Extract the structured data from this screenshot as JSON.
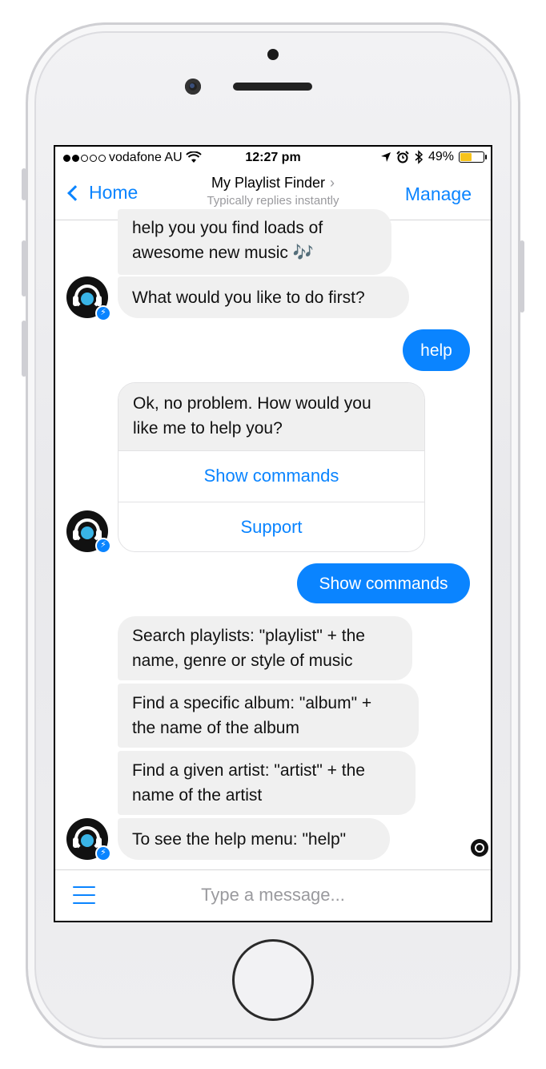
{
  "status_bar": {
    "carrier": "vodafone AU",
    "time": "12:27 pm",
    "battery": "49%",
    "battery_level": 0.49,
    "signal_bars_full": 2,
    "signal_bars_total": 5,
    "icons": [
      "wifi-icon",
      "location-arrow-icon",
      "alarm-icon",
      "bluetooth-icon",
      "battery-icon"
    ]
  },
  "nav": {
    "back_label": "Home",
    "title": "My Playlist Finder",
    "title_chevron": "›",
    "subtitle": "Typically replies instantly",
    "manage_label": "Manage"
  },
  "messages": {
    "bot1_line": "help you you find loads of",
    "bot1_line2": "awesome new music",
    "bot1_emoji": "🎶",
    "bot2": "What would you like to do first?",
    "user1": "help",
    "card_text_line1": "Ok, no problem. How would you",
    "card_text_line2": "like me to help you?",
    "card_btn1": "Show commands",
    "card_btn2": "Support",
    "user2": "Show commands",
    "cmd1_line1": "Search playlists: \"playlist\" + the",
    "cmd1_line2": "name, genre or style of music",
    "cmd2_line1": "Find a specific album: \"album\" +",
    "cmd2_line2": "the name of the album",
    "cmd3_line1": "Find a given artist: \"artist\" + the",
    "cmd3_line2": "name of the artist",
    "cmd4": "To see the help menu: \"help\""
  },
  "composer": {
    "placeholder": "Type a message..."
  },
  "colors": {
    "accent": "#0a84ff",
    "bubble_bot": "#f0f0f0",
    "battery": "#f7c31b"
  }
}
